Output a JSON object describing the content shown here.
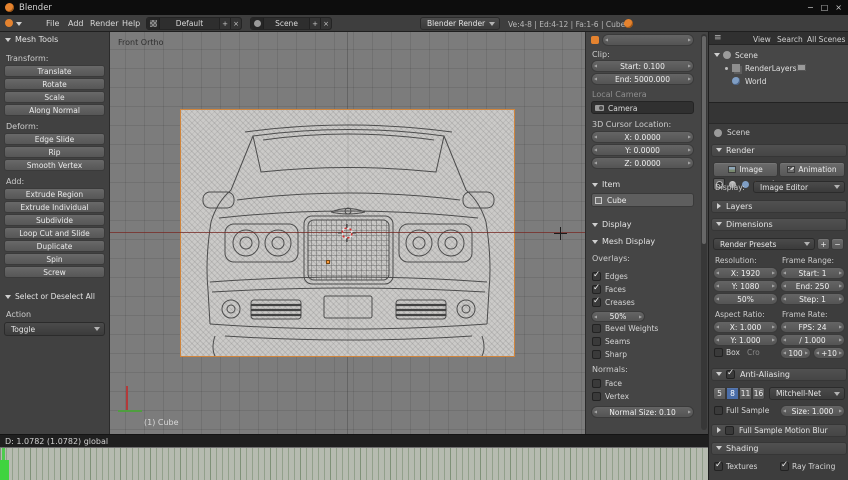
{
  "titlebar": {
    "title": "Blender"
  },
  "menubar": {
    "file": "File",
    "add": "Add",
    "render": "Render",
    "help": "Help",
    "layout_value": "Default",
    "scene_value": "Scene",
    "engine_value": "Blender Render",
    "stats": "Ve:4-8 | Ed:4-12 | Fa:1-6 | Cube"
  },
  "toolshelf": {
    "header_mesh_tools": "Mesh Tools",
    "transform_label": "Transform:",
    "transform": [
      "Translate",
      "Rotate",
      "Scale",
      "Along Normal"
    ],
    "deform_label": "Deform:",
    "deform": [
      "Edge Slide",
      "Rip",
      "Smooth Vertex"
    ],
    "add_label": "Add:",
    "add": [
      "Extrude Region",
      "Extrude Individual",
      "Subdivide",
      "Loop Cut and Slide",
      "Duplicate",
      "Spin",
      "Screw"
    ],
    "header_select": "Select or Deselect All",
    "action_label": "Action",
    "action_value": "Toggle"
  },
  "viewport": {
    "view_name": "Front Ortho",
    "object_info": "(1) Cube"
  },
  "npanel": {
    "clip_label": "Clip:",
    "clip_start": "Start: 0.100",
    "clip_end": "End: 5000.000",
    "local_camera_label": "Local Camera",
    "camera_name": "Camera",
    "cursor_label": "3D Cursor Location:",
    "cursor_x": "X: 0.0000",
    "cursor_y": "Y: 0.0000",
    "cursor_z": "Z: 0.0000",
    "item_header": "Item",
    "item_name": "Cube",
    "display_header": "Display",
    "mesh_display_header": "Mesh Display",
    "overlays_label": "Overlays:",
    "cb_edges": "Edges",
    "cb_faces": "Faces",
    "cb_creases": "Creases",
    "opacity_value": "50%",
    "cb_bevel_weights": "Bevel Weights",
    "cb_seams": "Seams",
    "cb_sharp": "Sharp",
    "normals_label": "Normals:",
    "cb_face": "Face",
    "cb_vertex": "Vertex",
    "normal_size": "Normal Size: 0.10"
  },
  "outliner": {
    "view_menu": "View",
    "search_menu": "Search",
    "scope": "All Scenes",
    "scene": "Scene",
    "renderlayers": "RenderLayers",
    "world": "World"
  },
  "properties": {
    "context": "Scene",
    "render_header": "Render",
    "image_button": "Image",
    "animation_button": "Animation",
    "display_label": "Display:",
    "display_value": "Image Editor",
    "layers_header": "Layers",
    "dimensions_header": "Dimensions",
    "presets_value": "Render Presets",
    "resolution_label": "Resolution:",
    "res_x": "X: 1920",
    "res_y": "Y: 1080",
    "res_pct": "50%",
    "frame_range_label": "Frame Range:",
    "frame_start": "Start: 1",
    "frame_end": "End: 250",
    "frame_step": "Step: 1",
    "aspect_label": "Aspect Ratio:",
    "aspect_x": "X: 1.000",
    "aspect_y": "Y: 1.000",
    "frame_rate_label": "Frame Rate:",
    "fps": "FPS: 24",
    "fps_base": "/ 1.000",
    "border_label": "Box",
    "crop_label": "Cro",
    "remap_a": "100",
    "remap_b": "+10",
    "aa_header": "Anti-Aliasing",
    "aa_samples": [
      "5",
      "8",
      "11",
      "16"
    ],
    "aa_selected_sample": "8",
    "aa_filter": "Mitchell-Net",
    "full_sample_label": "Full Sample",
    "aa_size": "Size: 1.000",
    "motion_blur_header": "Full Sample Motion Blur",
    "shading_header": "Shading",
    "textures_label": "Textures",
    "ray_tracing_label": "Ray Tracing"
  },
  "statusbar": {
    "text": "D: 1.0782 (1.0782) global"
  },
  "icons": {
    "minimize": "−",
    "maximize": "□",
    "close": "×",
    "plus": "+",
    "minus": "−",
    "menu": "≡"
  },
  "colors": {
    "accent_orange": "#e5832f",
    "selection_blue": "#4a6da8",
    "timeline_green": "#4ecb4e",
    "viewport_gray": "#7c7c7c"
  }
}
